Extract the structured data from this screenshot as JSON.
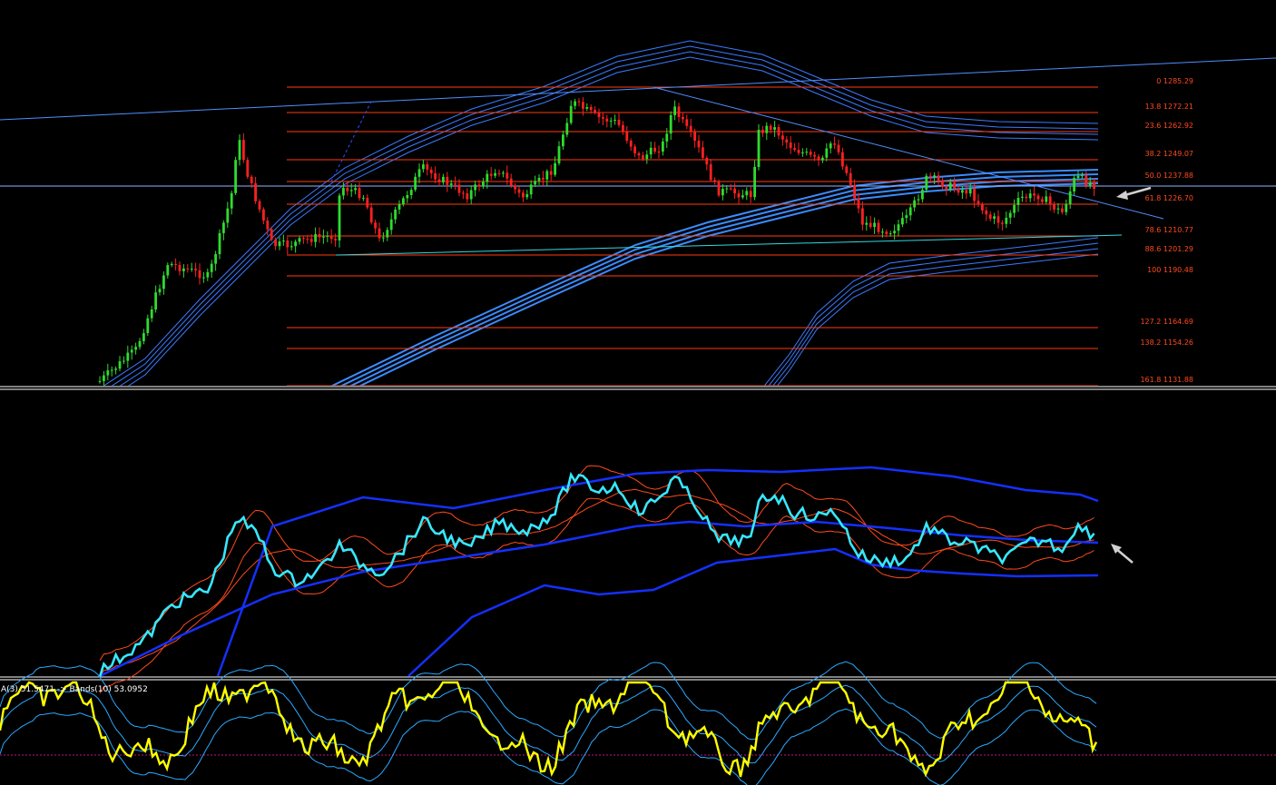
{
  "colors": {
    "background": "#000000",
    "fib_line": "#ff3b10",
    "trend_line": "#4f8fff",
    "ma_band": "#3a7bff",
    "candle_up": "#2edb2e",
    "candle_down": "#ff2020",
    "rsi_line": "#37e8ff",
    "bb_outer": "#1430ff",
    "bb_inner": "#ff4a1c",
    "stoch_line": "#ffff00",
    "stoch_band": "#2aa9ff",
    "separator": "#ffffff",
    "arrow": "#d0d0d0"
  },
  "fib_levels": [
    {
      "label": "0 1285.29"
    },
    {
      "label": "13.8 1272.21"
    },
    {
      "label": "23.6 1262.92"
    },
    {
      "label": "38.2 1249.07"
    },
    {
      "label": "50.0 1237.88"
    },
    {
      "label": "61.8 1226.70"
    },
    {
      "label": "78.6 1210.77"
    },
    {
      "label": "88.6 1201.29"
    },
    {
      "label": "100 1190.48"
    },
    {
      "label": "127.2 1164.69"
    },
    {
      "label": "138.2 1154.26"
    },
    {
      "label": "161.8 1131.88"
    }
  ],
  "indicator_panel": {
    "label": "A(3) 51.5471  -> Bands(10) 53.0952"
  },
  "icons": [
    "price-arrow-icon",
    "rsi-arrow-icon"
  ]
}
